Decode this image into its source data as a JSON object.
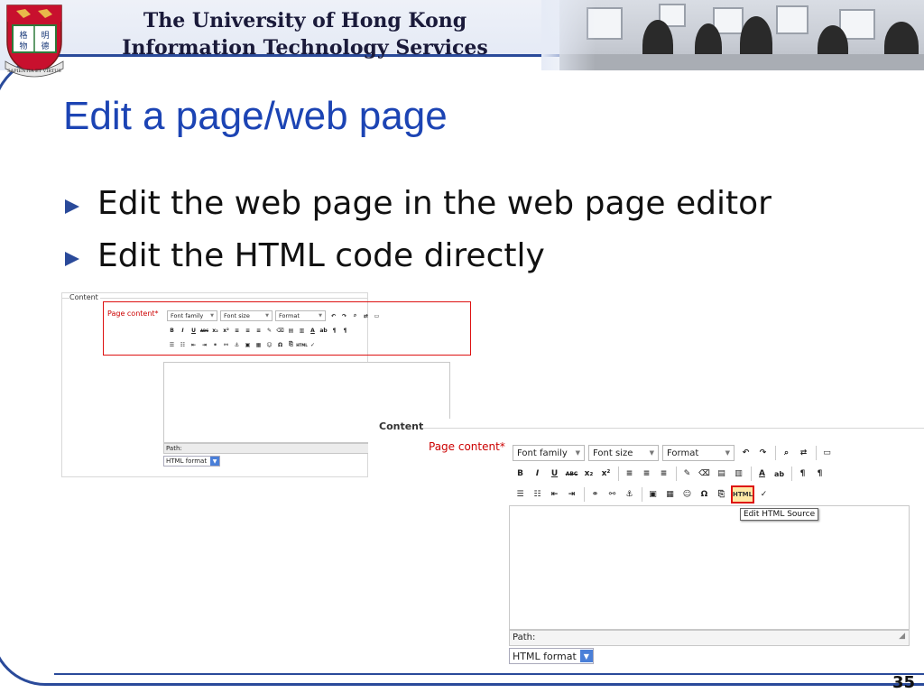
{
  "header": {
    "line1": "The University of Hong Kong",
    "line2": "Information Technology Services",
    "crest_motto": "SAPIENTIA ET VIRTUS"
  },
  "slide": {
    "title": "Edit a page/web page",
    "bullets": [
      "Edit the web page in the web page editor",
      "Edit the HTML code directly"
    ],
    "page_number": "35"
  },
  "editor_small": {
    "legend": "Content",
    "field_label": "Page content",
    "required_mark": "*",
    "font_family": "Font family",
    "font_size": "Font size",
    "format": "Format",
    "path_label": "Path:",
    "format_select": "HTML format"
  },
  "editor_large": {
    "legend": "Content",
    "field_label": "Page content",
    "required_mark": "*",
    "font_family": "Font family",
    "font_size": "Font size",
    "format": "Format",
    "html_button": "HTML",
    "tooltip": "Edit HTML Source",
    "path_label": "Path:",
    "format_select": "HTML format"
  },
  "colors": {
    "title": "#1c44b4",
    "frame": "#2a4a9a",
    "highlight_red": "#d11111",
    "required": "#cc0000"
  },
  "icons": {
    "bullet": "triangle-bullet-icon",
    "crest": "hku-crest-icon",
    "dropdown": "chevron-down-icon"
  }
}
